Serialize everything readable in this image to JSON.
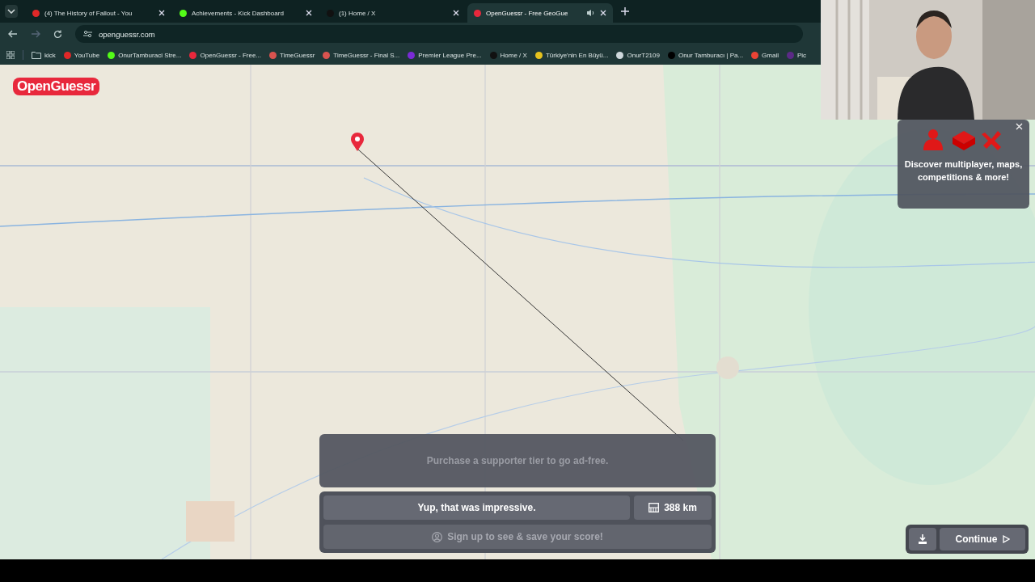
{
  "browser": {
    "tabs": [
      {
        "title": "(4) The History of Fallout - You",
        "color": "#e02828",
        "audio": false,
        "selected": false
      },
      {
        "title": "Achievements - Kick Dashboard",
        "color": "#53fc18",
        "audio": false,
        "selected": false
      },
      {
        "title": "(1) Home / X",
        "color": "#111111",
        "audio": false,
        "selected": false
      },
      {
        "title": "OpenGuessr - Free GeoGue",
        "color": "#e8283c",
        "audio": true,
        "selected": true
      }
    ],
    "address": "openguessr.com",
    "bookmarks": [
      {
        "kind": "folder",
        "label": "kick"
      },
      {
        "kind": "site",
        "label": "YouTube",
        "color": "#e02828"
      },
      {
        "kind": "site",
        "label": "OnurTamburaci Stre...",
        "color": "#53fc18"
      },
      {
        "kind": "site",
        "label": "OpenGuessr - Free...",
        "color": "#e8283c"
      },
      {
        "kind": "site",
        "label": "TimeGuessr",
        "color": "#d9534f"
      },
      {
        "kind": "site",
        "label": "TimeGuessr - Final S...",
        "color": "#d9534f"
      },
      {
        "kind": "site",
        "label": "Premier League Pre...",
        "color": "#7a2bd6"
      },
      {
        "kind": "site",
        "label": "Home / X",
        "color": "#111111"
      },
      {
        "kind": "site",
        "label": "Türkiye'nin En Büyü...",
        "color": "#e6c21e"
      },
      {
        "kind": "site",
        "label": "OnurT2109",
        "color": "#cfd8dc"
      },
      {
        "kind": "site",
        "label": "Onur Tamburacı | Pa...",
        "color": "#000000"
      },
      {
        "kind": "site",
        "label": "Gmail",
        "color": "#ea4335"
      },
      {
        "kind": "site",
        "label": "Pic",
        "color": "#5b2a86"
      }
    ]
  },
  "game": {
    "logo": "OpenGuessr",
    "promo": {
      "text": "Discover multiplayer, maps, competitions & more!"
    },
    "ad_notice": "Purchase a supporter tier to go ad-free.",
    "result": {
      "message": "Yup, that was impressive.",
      "distance": "388 km",
      "signup": "Sign up to see & save your score!"
    },
    "continue_button": "Continue"
  }
}
